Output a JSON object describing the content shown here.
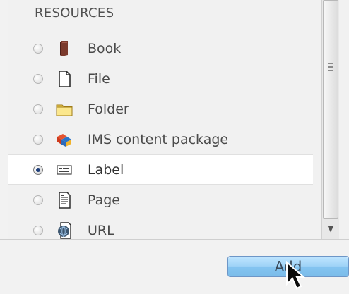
{
  "resources": {
    "header": "RESOURCES",
    "items": [
      {
        "label": "Book",
        "icon": "book-icon",
        "selected": false
      },
      {
        "label": "File",
        "icon": "file-icon",
        "selected": false
      },
      {
        "label": "Folder",
        "icon": "folder-icon",
        "selected": false
      },
      {
        "label": "IMS content package",
        "icon": "ims-package-icon",
        "selected": false
      },
      {
        "label": "Label",
        "icon": "label-icon",
        "selected": true
      },
      {
        "label": "Page",
        "icon": "page-icon",
        "selected": false
      },
      {
        "label": "URL",
        "icon": "url-icon",
        "selected": false
      }
    ]
  },
  "actions": {
    "add_label": "Add"
  },
  "colors": {
    "panel_background": "#f1f1f1",
    "selected_background": "#ffffff",
    "button_blue": "#9fd3f7",
    "text": "#4a4a4a"
  }
}
